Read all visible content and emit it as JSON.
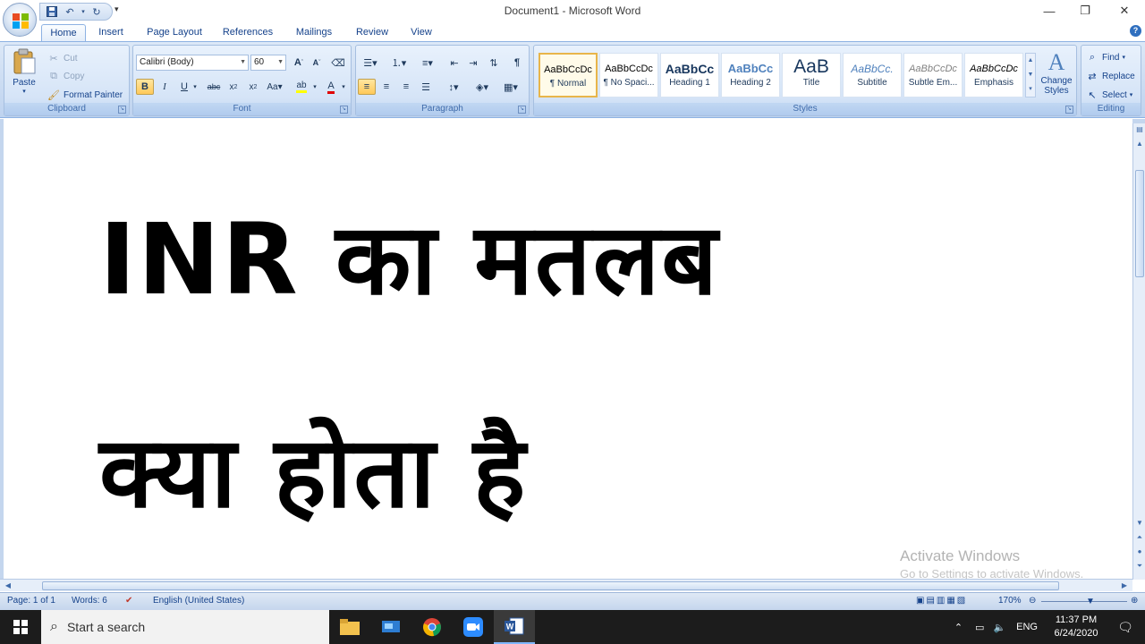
{
  "window": {
    "title": "Document1 - Microsoft Word"
  },
  "quick_access": {
    "save_icon": "save-icon",
    "undo_icon": "undo-icon",
    "redo_icon": "redo-icon"
  },
  "tabs": [
    "Home",
    "Insert",
    "Page Layout",
    "References",
    "Mailings",
    "Review",
    "View"
  ],
  "active_tab": "Home",
  "clipboard": {
    "paste": "Paste",
    "cut": "Cut",
    "copy": "Copy",
    "format_painter": "Format Painter",
    "label": "Clipboard"
  },
  "font": {
    "family": "Calibri (Body)",
    "size": "60",
    "label": "Font"
  },
  "paragraph": {
    "label": "Paragraph"
  },
  "styles": {
    "label": "Styles",
    "items": [
      {
        "preview": "AaBbCcDc",
        "name": "¶ Normal"
      },
      {
        "preview": "AaBbCcDc",
        "name": "¶ No Spaci..."
      },
      {
        "preview": "AaBbCc",
        "name": "Heading 1"
      },
      {
        "preview": "AaBbCc",
        "name": "Heading 2"
      },
      {
        "preview": "AaB",
        "name": "Title"
      },
      {
        "preview": "AaBbCc.",
        "name": "Subtitle"
      },
      {
        "preview": "AaBbCcDc",
        "name": "Subtle Em..."
      },
      {
        "preview": "AaBbCcDc",
        "name": "Emphasis"
      }
    ],
    "change_styles": "Change Styles"
  },
  "editing": {
    "find": "Find",
    "replace": "Replace",
    "select": "Select",
    "label": "Editing"
  },
  "document": {
    "line1": "INR  का  मतलब",
    "line2": "क्या  होता  है"
  },
  "watermark": {
    "title": "Activate Windows",
    "subtitle": "Go to Settings to activate Windows."
  },
  "status": {
    "page": "Page: 1 of 1",
    "words": "Words: 6",
    "language": "English (United States)",
    "zoom": "170%"
  },
  "taskbar": {
    "search_placeholder": "Start a search",
    "lang": "ENG",
    "time": "11:37 PM",
    "date": "6/24/2020"
  }
}
